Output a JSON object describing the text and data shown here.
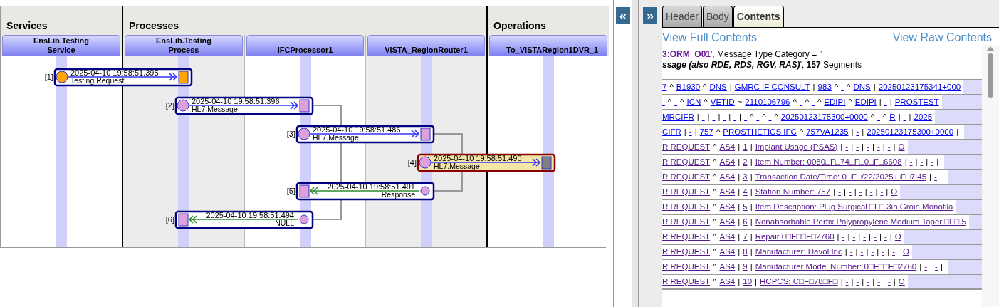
{
  "diagram": {
    "groups": [
      {
        "title": "Services",
        "lanes": [
          {
            "name": "EnsLib.Testing Service"
          }
        ]
      },
      {
        "title": "Processes",
        "lanes": [
          {
            "name": "EnsLib.Testing Process"
          },
          {
            "name": "IFCProcessor1"
          },
          {
            "name": "VISTA_RegionRouter1"
          }
        ]
      },
      {
        "title": "Operations",
        "lanes": [
          {
            "name": "To_VISTARegion1DVR_1"
          }
        ]
      }
    ],
    "messages": [
      {
        "index": "[1]",
        "time": "2025-04-10 19:58:51.395",
        "type": "Testing.Request",
        "kind": "request",
        "selected": false,
        "source": {
          "color": "#ffa500"
        },
        "target": {
          "color": "#ffa500"
        }
      },
      {
        "index": "[2]",
        "time": "2025-04-10 19:58:51.396",
        "type": "HL7.Message",
        "kind": "request",
        "selected": false,
        "source": {
          "color": "#dda0dd"
        },
        "target": {
          "color": "#dda0dd"
        }
      },
      {
        "index": "[3]",
        "time": "2025-04-10 19:58:51.486",
        "type": "HL7.Message",
        "kind": "request",
        "selected": false,
        "source": {
          "color": "#dda0dd"
        },
        "target": {
          "color": "#dda0dd"
        }
      },
      {
        "index": "[4]",
        "time": "2025-04-10 19:58:51.490",
        "type": "HL7.Message",
        "kind": "async",
        "selected": true,
        "source": {
          "color": "#dda0dd"
        },
        "target": {
          "color": "#808080"
        }
      },
      {
        "index": "[5]",
        "time": "2025-04-10 19:58:51.491",
        "type": "Response",
        "kind": "response",
        "selected": false,
        "source": {
          "color": "#dda0dd"
        },
        "target": {
          "color": "#dda0dd"
        }
      },
      {
        "index": "[6]",
        "time": "2025-04-10 19:58:51.494",
        "type": "NULL",
        "kind": "response",
        "selected": false,
        "source": {
          "color": "#dda0dd"
        },
        "target": {
          "color": "#dda0dd"
        }
      }
    ]
  },
  "collapse_button": "«",
  "expand_button": "»",
  "tabs": [
    {
      "label": "Header",
      "selected": false
    },
    {
      "label": "Body",
      "selected": false
    },
    {
      "label": "Contents",
      "selected": true
    }
  ],
  "links": {
    "full": "View Full Contents",
    "raw": "View Raw Contents"
  },
  "info": {
    "type_link": "3:ORM_O01",
    "line1": "', Message Type Category = ''",
    "line2": "*ssage (also RDE, RDS, RGV, RAS)*', **157** Segments"
  },
  "segments": [
    {
      "visited": false,
      "fields": [
        "7",
        "B1930",
        "DNS",
        "GMRC IF CONSULT",
        "983",
        "-",
        "DNS",
        "20250123175341+000"
      ],
      "separators": [
        "^",
        "^",
        "|",
        "|",
        "^",
        "^",
        "|"
      ]
    },
    {
      "visited": false,
      "fields": [
        "-",
        "-",
        "ICN",
        "VETID",
        "2110106796",
        "-",
        "-",
        "EDIPI",
        "EDIPI",
        "-",
        "PROSTEST"
      ],
      "separators": [
        "^",
        "^",
        "^",
        "~",
        "^",
        "^",
        "^",
        "^",
        "|",
        "|"
      ]
    },
    {
      "visited": false,
      "fields": [
        "MRCIFR",
        "-",
        "-",
        "-",
        "-",
        "-",
        "-",
        "-",
        "20250123175300+0000",
        "-",
        "R",
        "-",
        "2025"
      ],
      "separators": [
        "|",
        "|",
        "|",
        "|",
        "|",
        "^",
        "^",
        "^",
        "^",
        "^",
        "|",
        "|"
      ]
    },
    {
      "visited": false,
      "fields": [
        "CIFR",
        "-",
        "757",
        "PROSTHETICS IFC",
        "757VA1235",
        "-",
        "20250123175300+0000"
      ],
      "separators": [
        "|",
        "|",
        "^",
        "^",
        "|",
        "|",
        "|"
      ]
    },
    {
      "visited": true,
      "fields": [
        "R REQUEST",
        "AS4",
        "1",
        "Implant Usage (PSAS)",
        "-",
        "-",
        "-",
        "-",
        "-",
        "O"
      ],
      "separators": [
        "^",
        "|",
        "|",
        "|",
        "|",
        "|",
        "|",
        "|",
        "|"
      ]
    },
    {
      "visited": true,
      "fields": [
        "R REQUEST",
        "AS4",
        "2",
        "Item Number: 0080□F□74□F□0□F□6608",
        "-",
        "-",
        "-"
      ],
      "separators": [
        "^",
        "|",
        "|",
        "|",
        "|",
        "|",
        "|"
      ]
    },
    {
      "visited": true,
      "fields": [
        "R REQUEST",
        "AS4",
        "3",
        "Transaction Date/Time: 0□F□/22/2025 □F□7:45",
        "-"
      ],
      "separators": [
        "^",
        "|",
        "|",
        "|",
        "|"
      ]
    },
    {
      "visited": true,
      "fields": [
        "R REQUEST",
        "AS4",
        "4",
        "Station Number: 757",
        "-",
        "-",
        "-",
        "-",
        "-",
        "O"
      ],
      "separators": [
        "^",
        "|",
        "|",
        "|",
        "|",
        "|",
        "|",
        "|",
        "|"
      ]
    },
    {
      "visited": true,
      "fields": [
        "R REQUEST",
        "AS4",
        "5",
        "Item Description: Plug Surgical □F□.3in Groin Monofila"
      ],
      "separators": [
        "^",
        "|",
        "|"
      ]
    },
    {
      "visited": true,
      "fields": [
        "R REQUEST",
        "AS4",
        "6",
        "Nonabsorbable Perfix Polypropylene Medium Taper □F□.5"
      ],
      "separators": [
        "^",
        "|",
        "|"
      ]
    },
    {
      "visited": true,
      "fields": [
        "R REQUEST",
        "AS4",
        "7",
        "Repair 0□F□□F□2760",
        "-",
        "-",
        "-",
        "-",
        "-",
        "O"
      ],
      "separators": [
        "^",
        "|",
        "|",
        "|",
        "|",
        "|",
        "|",
        "|",
        "|"
      ]
    },
    {
      "visited": true,
      "fields": [
        "R REQUEST",
        "AS4",
        "8",
        "Manufacturer: Davol Inc",
        "-",
        "-",
        "-",
        "-",
        "-",
        "O"
      ],
      "separators": [
        "^",
        "|",
        "|",
        "|",
        "|",
        "|",
        "|",
        "|",
        "|"
      ]
    },
    {
      "visited": true,
      "fields": [
        "R REQUEST",
        "AS4",
        "9",
        "Manufacturer Model Number: 0□F□□F□2760",
        "-",
        "-"
      ],
      "separators": [
        "^",
        "|",
        "|",
        "|",
        "|",
        "|"
      ]
    },
    {
      "visited": true,
      "fields": [
        "R REQUEST",
        "AS4",
        "10",
        "HCPCS: C□F□78□F□",
        "-",
        "-",
        "-",
        "-",
        "-",
        "O"
      ],
      "separators": [
        "^",
        "|",
        "|",
        "|",
        "|",
        "|",
        "|",
        "|",
        "|"
      ]
    }
  ]
}
